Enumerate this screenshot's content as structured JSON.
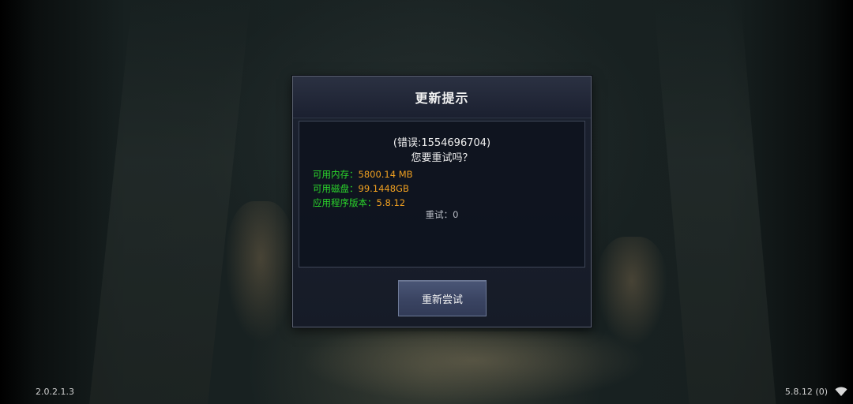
{
  "dialog": {
    "title": "更新提示",
    "error_text": "(错误:1554696704)",
    "question": "您要重试吗？",
    "info": [
      {
        "label": "可用内存：",
        "value": "5800.14 MB"
      },
      {
        "label": "可用磁盘：",
        "value": "99.1448GB"
      },
      {
        "label": "应用程序版本：",
        "value": "5.8.12"
      }
    ],
    "retry_count_text": "重试：0",
    "retry_button_label": "重新尝试"
  },
  "footer": {
    "left_version": "2.0.2.1.3",
    "right_version": "5.8.12 (0)",
    "wifi_icon": "wifi-icon"
  },
  "colors": {
    "info_label": "#2bd62b",
    "info_value": "#f0a020"
  }
}
